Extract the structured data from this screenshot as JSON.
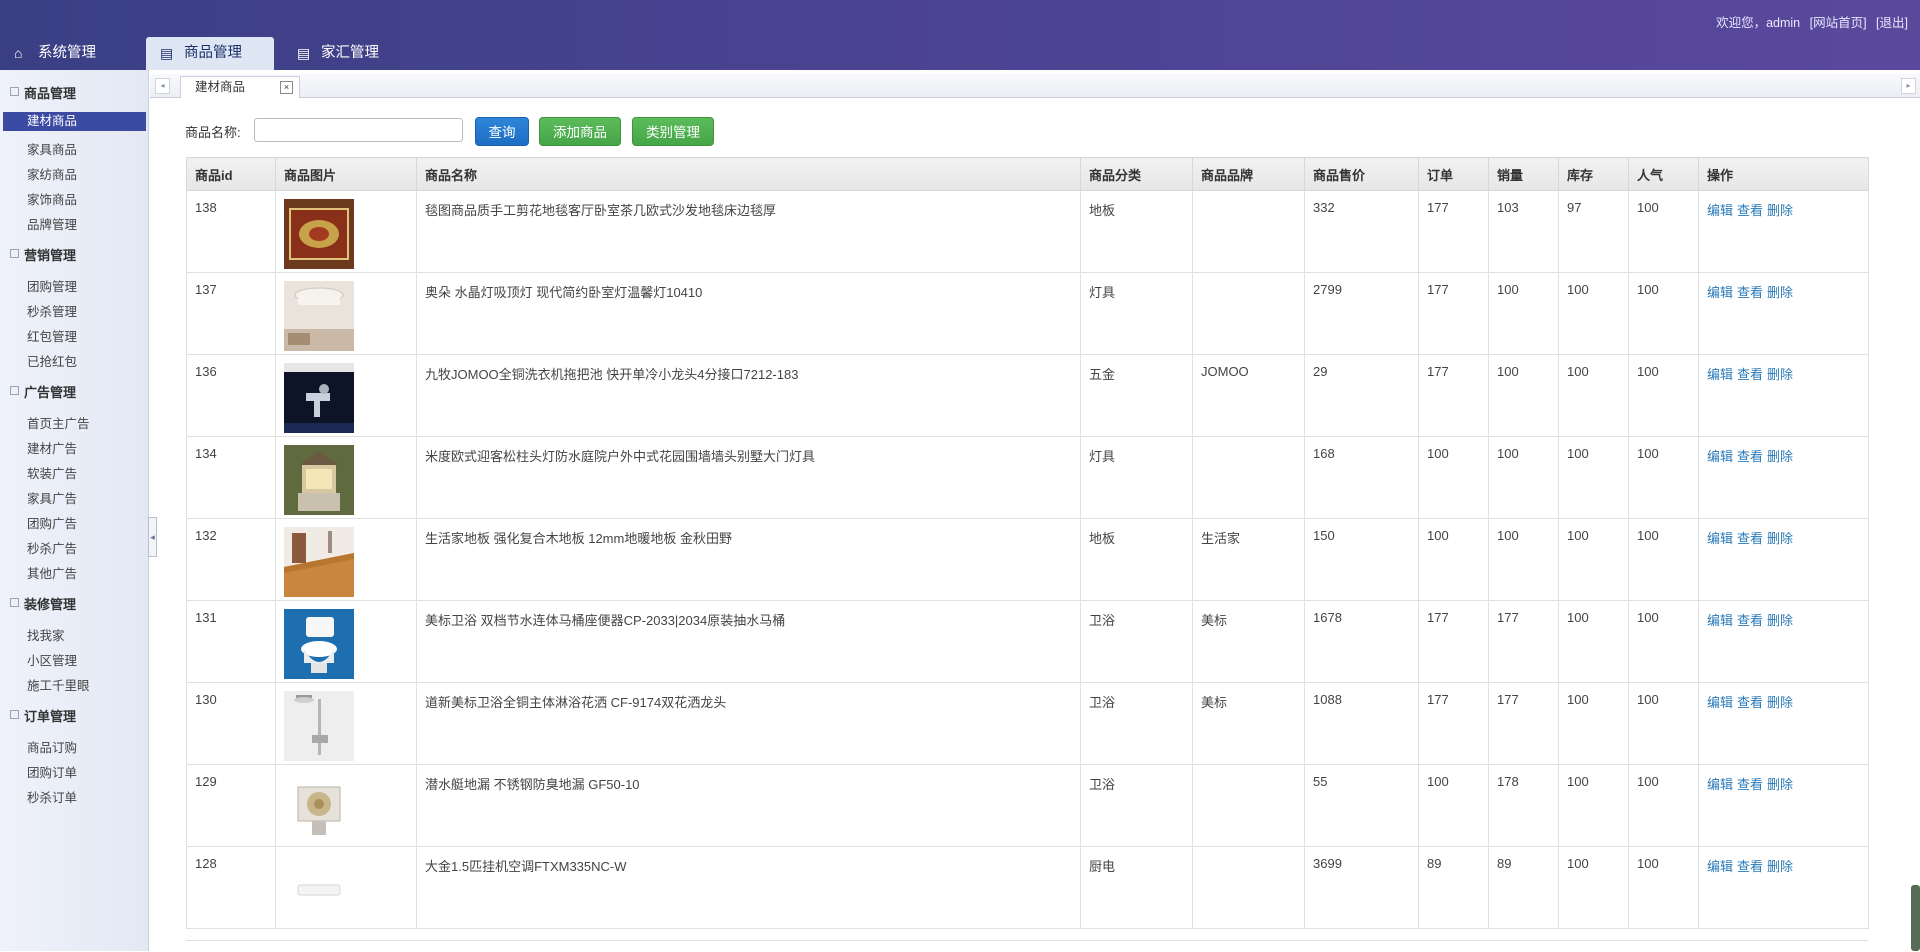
{
  "header": {
    "welcome": "欢迎您，admin",
    "home_link": "[网站首页]",
    "logout_link": "[退出]",
    "tabs": [
      {
        "label": "系统管理",
        "icon": "home-icon"
      },
      {
        "label": "商品管理",
        "icon": "list-icon"
      },
      {
        "label": "家汇管理",
        "icon": "list-icon"
      }
    ]
  },
  "sidebar": {
    "sections": [
      {
        "title": "商品管理",
        "items": [
          "建材商品",
          "家具商品",
          "家纺商品",
          "家饰商品",
          "品牌管理"
        ]
      },
      {
        "title": "营销管理",
        "items": [
          "团购管理",
          "秒杀管理",
          "红包管理",
          "已抢红包"
        ]
      },
      {
        "title": "广告管理",
        "items": [
          "首页主广告",
          "建材广告",
          "软装广告",
          "家具广告",
          "团购广告",
          "秒杀广告",
          "其他广告"
        ]
      },
      {
        "title": "装修管理",
        "items": [
          "找我家",
          "小区管理",
          "施工千里眼"
        ]
      },
      {
        "title": "订单管理",
        "items": [
          "商品订购",
          "团购订单",
          "秒杀订单"
        ]
      }
    ],
    "active_item": "建材商品"
  },
  "page_tab": {
    "label": "建材商品",
    "close": "×"
  },
  "search": {
    "label": "商品名称:",
    "value": "",
    "placeholder": "",
    "query_button": "查询",
    "add_button": "添加商品",
    "category_button": "类别管理"
  },
  "table": {
    "columns": [
      "商品id",
      "商品图片",
      "商品名称",
      "商品分类",
      "商品品牌",
      "商品售价",
      "订单",
      "销量",
      "库存",
      "人气",
      "操作"
    ],
    "actions": [
      "编辑",
      "查看",
      "删除"
    ],
    "rows": [
      {
        "id": "138",
        "name": "毯图商品质手工剪花地毯客厅卧室茶几欧式沙发地毯床边毯厚",
        "category": "地板",
        "brand": "",
        "price": "332",
        "orders": "177",
        "sales": "103",
        "stock": "97",
        "popularity": "100",
        "thumb": "rug"
      },
      {
        "id": "137",
        "name": "奥朵 水晶灯吸顶灯 现代简约卧室灯温馨灯10410",
        "category": "灯具",
        "brand": "",
        "price": "2799",
        "orders": "177",
        "sales": "100",
        "stock": "100",
        "popularity": "100",
        "thumb": "chandelier"
      },
      {
        "id": "136",
        "name": "九牧JOMOO全铜洗衣机拖把池 快开单冷小龙头4分接口7212-183",
        "category": "五金",
        "brand": "JOMOO",
        "price": "29",
        "orders": "177",
        "sales": "100",
        "stock": "100",
        "popularity": "100",
        "thumb": "faucet"
      },
      {
        "id": "134",
        "name": "米度欧式迎客松柱头灯防水庭院户外中式花园围墙墙头别墅大门灯具",
        "category": "灯具",
        "brand": "",
        "price": "168",
        "orders": "100",
        "sales": "100",
        "stock": "100",
        "popularity": "100",
        "thumb": "pillar-lamp"
      },
      {
        "id": "132",
        "name": "生活家地板 强化复合木地板 12mm地暖地板 金秋田野",
        "category": "地板",
        "brand": "生活家",
        "price": "150",
        "orders": "100",
        "sales": "100",
        "stock": "100",
        "popularity": "100",
        "thumb": "floor"
      },
      {
        "id": "131",
        "name": "美标卫浴 双档节水连体马桶座便器CP-2033|2034原装抽水马桶",
        "category": "卫浴",
        "brand": "美标",
        "price": "1678",
        "orders": "177",
        "sales": "177",
        "stock": "100",
        "popularity": "100",
        "thumb": "toilet"
      },
      {
        "id": "130",
        "name": "道新美标卫浴全铜主体淋浴花洒 CF-9174双花洒龙头",
        "category": "卫浴",
        "brand": "美标",
        "price": "1088",
        "orders": "177",
        "sales": "177",
        "stock": "100",
        "popularity": "100",
        "thumb": "shower"
      },
      {
        "id": "129",
        "name": "潜水艇地漏 不锈钢防臭地漏 GF50-10",
        "category": "卫浴",
        "brand": "",
        "price": "55",
        "orders": "100",
        "sales": "178",
        "stock": "100",
        "popularity": "100",
        "thumb": "drain"
      },
      {
        "id": "128",
        "name": "大金1.5匹挂机空调FTXM335NC-W",
        "category": "厨电",
        "brand": "",
        "price": "3699",
        "orders": "89",
        "sales": "89",
        "stock": "100",
        "popularity": "100",
        "thumb": "ac"
      }
    ]
  },
  "colors": {
    "header": "#4a4392",
    "sidebar_active": "#3b4aa3",
    "query_button": "#1d6ec4",
    "green_button": "#46a546",
    "link": "#2a7ab8"
  }
}
